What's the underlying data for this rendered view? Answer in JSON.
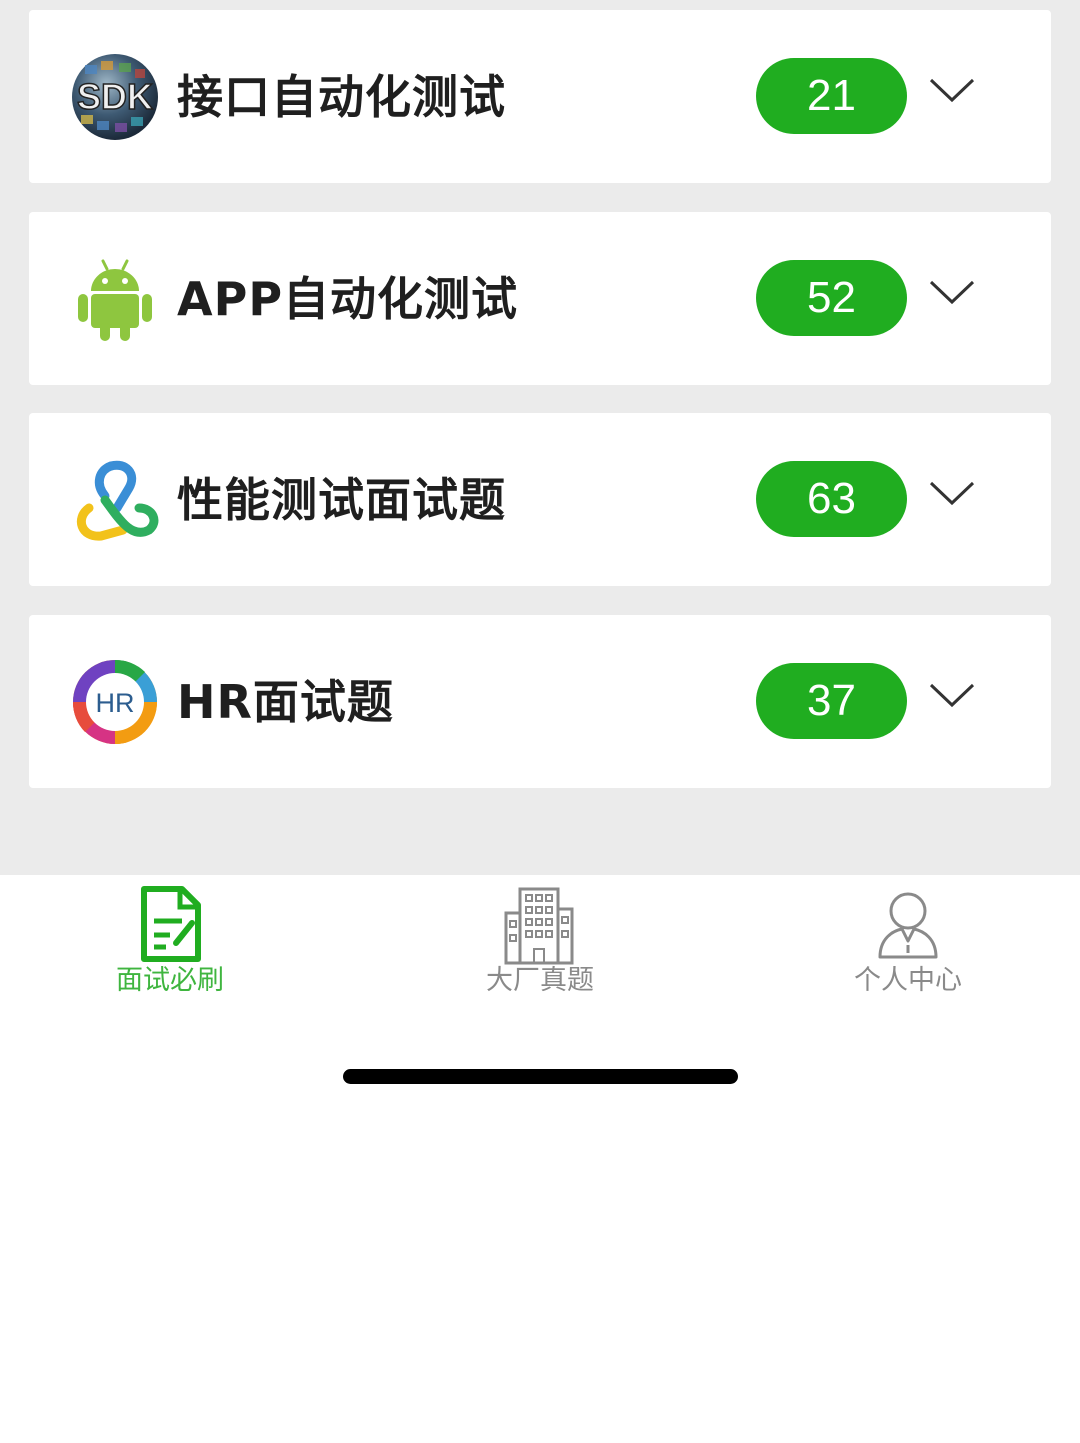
{
  "cards": [
    {
      "title": "接口自动化测试",
      "count": "21",
      "icon": "sdk-globe-icon",
      "sdk_text": "SDK"
    },
    {
      "title": "APP自动化测试",
      "count": "52",
      "icon": "android-robot-icon"
    },
    {
      "title": "性能测试面试题",
      "count": "63",
      "icon": "performance-link-icon"
    },
    {
      "title": "HR面试题",
      "count": "37",
      "icon": "hr-circle-icon",
      "hr_text": "HR"
    }
  ],
  "tabs": [
    {
      "label": "面试必刷",
      "icon": "document-edit-icon",
      "active": true
    },
    {
      "label": "大厂真题",
      "icon": "building-icon",
      "active": false
    },
    {
      "label": "个人中心",
      "icon": "user-icon",
      "active": false
    }
  ],
  "colors": {
    "accent": "#20ad20",
    "background": "#ebebeb",
    "inactive": "#8a8a8a",
    "title": "#1f1f1f"
  }
}
